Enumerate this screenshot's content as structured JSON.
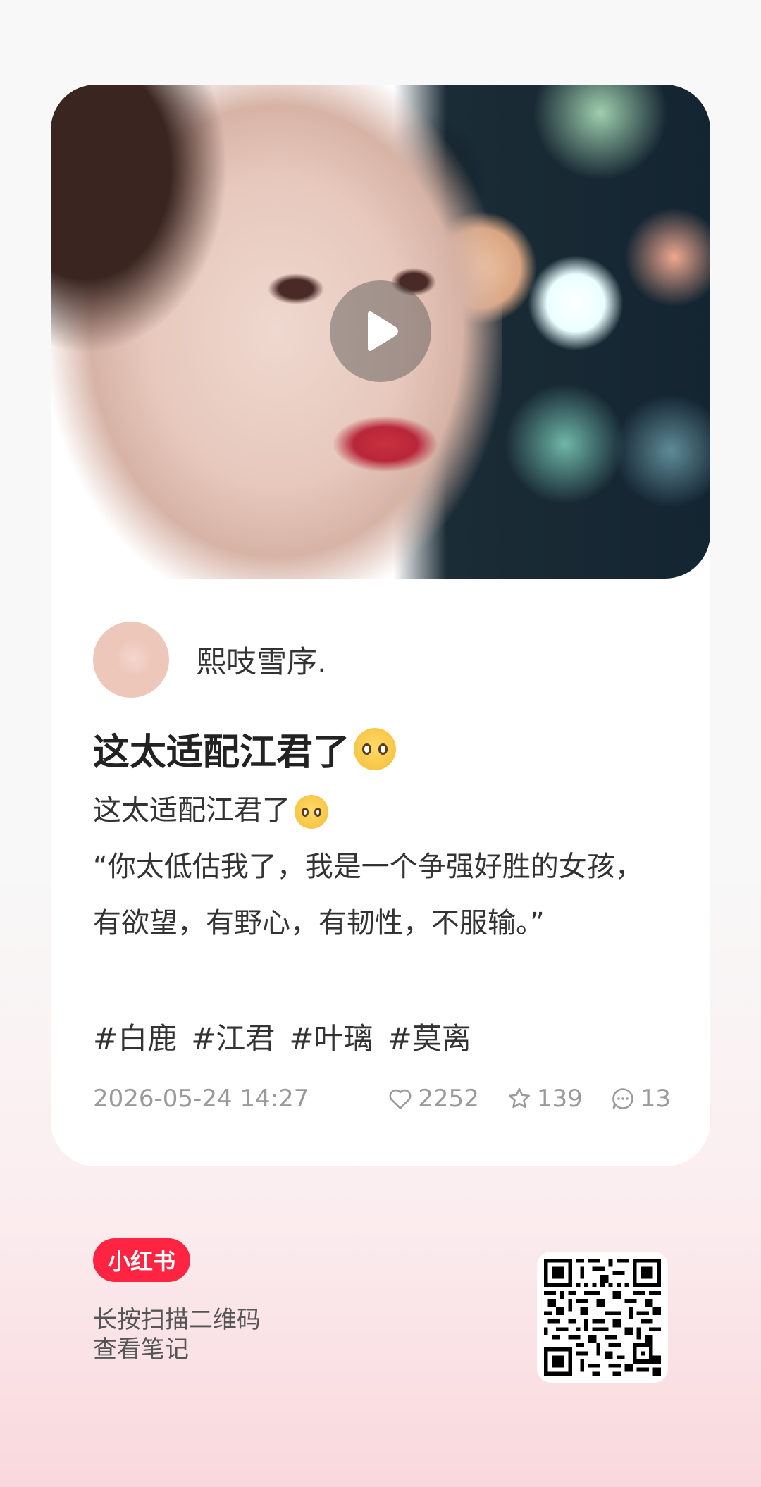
{
  "note": {
    "author_name": "熙吱雪序.",
    "title": "这太适配江君了",
    "body_line1": "这太适配江君了",
    "quote": "“你太低估我了，我是一个争强好胜的女孩，有欲望，有野心，有韧性，不服输。”",
    "tags": [
      "#白鹿",
      "#江君",
      "#叶璃",
      "#莫离"
    ],
    "date": "2026-05-24 14:27",
    "likes": "2252",
    "favorites": "139",
    "comments": "13"
  },
  "footer": {
    "logo_text": "小红书",
    "scan_line1": "长按扫描二维码",
    "scan_line2": "查看笔记"
  },
  "icons": {
    "play": "play-icon",
    "like": "heart-icon",
    "favorite": "star-icon",
    "comment": "comment-icon",
    "emoji": "crying-face-emoji"
  },
  "colors": {
    "brand": "#ff2442",
    "meta_text": "#9a9a9a"
  }
}
